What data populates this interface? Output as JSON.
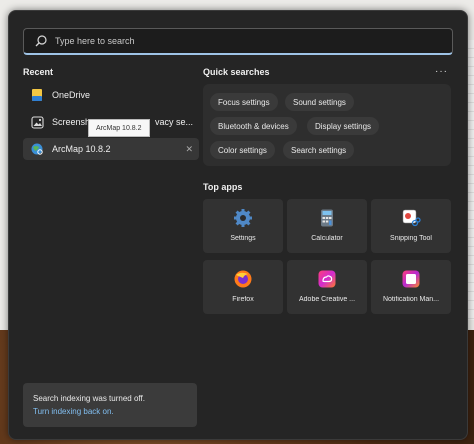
{
  "search": {
    "placeholder": "Type here to search"
  },
  "recent": {
    "title": "Recent",
    "items": [
      {
        "label": "OneDrive"
      },
      {
        "label": "Screensh",
        "label_tail": "vacy se..."
      },
      {
        "label": "ArcMap 10.8.2"
      }
    ],
    "tooltip": "ArcMap 10.8.2",
    "close_glyph": "✕"
  },
  "quick_searches": {
    "title": "Quick searches",
    "more_glyph": "···",
    "chips": [
      "Focus settings",
      "Sound settings",
      "Bluetooth & devices",
      "Display settings",
      "Color settings",
      "Search settings"
    ]
  },
  "top_apps": {
    "title": "Top apps",
    "apps": [
      {
        "label": "Settings",
        "icon": "settings-icon"
      },
      {
        "label": "Calculator",
        "icon": "calculator-icon"
      },
      {
        "label": "Snipping Tool",
        "icon": "snipping-tool-icon"
      },
      {
        "label": "Firefox",
        "icon": "firefox-icon"
      },
      {
        "label": "Adobe Creative ...",
        "icon": "adobe-creative-cloud-icon"
      },
      {
        "label": "Notification Man...",
        "icon": "notification-manager-icon"
      }
    ]
  },
  "indexing_notice": {
    "message": "Search indexing was turned off.",
    "link": "Turn indexing back on."
  },
  "colors": {
    "accent": "#82bff1",
    "panel": "#252525",
    "tile": "#323232"
  }
}
